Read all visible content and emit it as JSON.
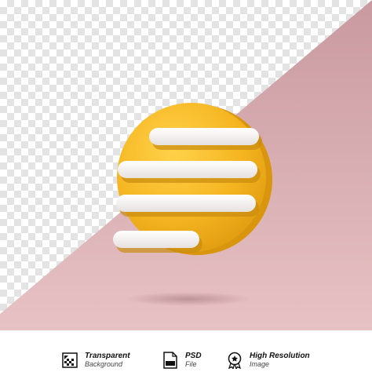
{
  "colors": {
    "badge_yellow": "#f5b521",
    "badge_highlight": "#ffd24a",
    "bar_white": "#f7f5f3",
    "backdrop_pink": "#d9a9ad"
  },
  "icon": {
    "name": "text-lines-badge-icon"
  },
  "features": [
    {
      "icon": "transparent-background-icon",
      "title": "Transparent",
      "subtitle": "Background"
    },
    {
      "icon": "psd-file-icon",
      "title": "PSD",
      "subtitle": "File"
    },
    {
      "icon": "high-resolution-badge-icon",
      "title": "High Resolution",
      "subtitle": "Image"
    }
  ]
}
